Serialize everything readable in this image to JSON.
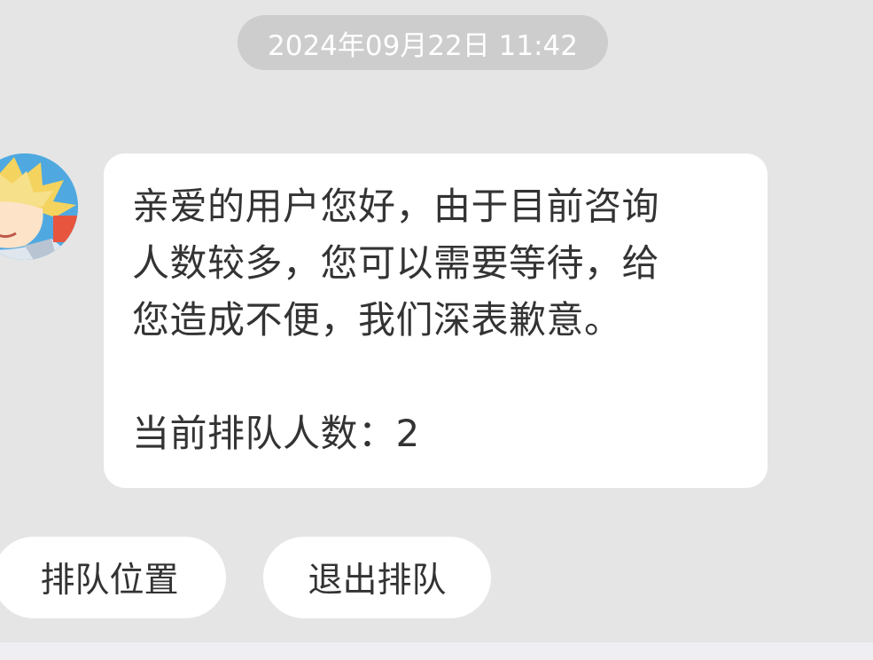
{
  "timestamp": "2024年09月22日 11:42",
  "agent_avatar": {
    "icon": "cartoon-character-avatar"
  },
  "message": {
    "lines": [
      "亲爱的用户您好，由于目前咨询",
      "人数较多，您可以需要等待，给",
      "您造成不便，我们深表歉意。"
    ],
    "queue_text": "当前排队人数：2"
  },
  "actions": {
    "queue_position": "排队位置",
    "exit_queue": "退出排队"
  },
  "colors": {
    "background": "#e5e5e5",
    "bubble": "#ffffff",
    "timestamp_pill": "#cdcdcd",
    "text": "#333333"
  }
}
